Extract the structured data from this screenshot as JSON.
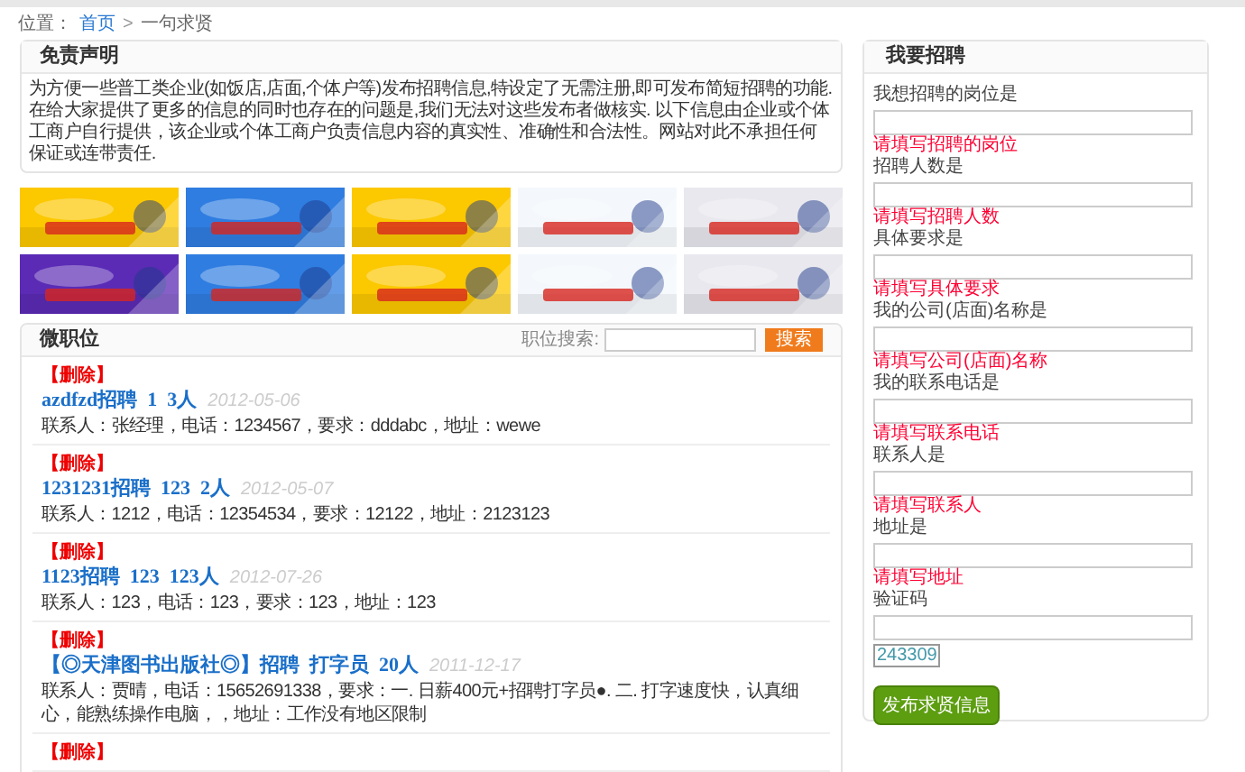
{
  "breadcrumb": {
    "label": "位置：",
    "home": "首页",
    "separator": ">",
    "current": "一句求贤"
  },
  "disclaimer": {
    "title": "免责声明",
    "text": "为方便一些普工类企业(如饭店,店面,个体户等)发布招聘信息,特设定了无需注册,即可发布简短招聘的功能.在给大家提供了更多的信息的同时也存在的问题是,我们无法对这些发布者做核实. 以下信息由企业或个体工商户自行提供，该企业或个体工商户负责信息内容的真实性、准确性和合法性。网站对此不承担任何保证或连带责任."
  },
  "jobs_panel": {
    "title": "微职位",
    "search_label": "职位搜索:",
    "search_button": "搜索",
    "jobs": [
      {
        "delete": "【删除】",
        "title": "azdfzd招聘  1  3人",
        "date": "2012-05-06",
        "details": "联系人：张经理，电话：1234567，要求：dddabc，地址：wewe"
      },
      {
        "delete": "【删除】",
        "title": "1231231招聘  123  2人",
        "date": "2012-05-07",
        "details": "联系人：1212，电话：12354534，要求：12122，地址：2123123"
      },
      {
        "delete": "【删除】",
        "title": "1123招聘  123  123人",
        "date": "2012-07-26",
        "details": "联系人：123，电话：123，要求：123，地址：123"
      },
      {
        "delete": "【删除】",
        "title": "【◎天津图书出版社◎】招聘  打字员  20人",
        "date": "2011-12-17",
        "details": "联系人：贾晴，电话：15652691338，要求：一. 日薪400元+招聘打字员●. 二. 打字速度快，认真细心，能熟练操作电脑，，地址：工作没有地区限制"
      },
      {
        "delete": "【删除】"
      }
    ]
  },
  "form": {
    "title": "我要招聘",
    "fields": [
      {
        "label": "我想招聘的岗位是",
        "error": "请填写招聘的岗位"
      },
      {
        "label": "招聘人数是",
        "error": "请填写招聘人数"
      },
      {
        "label": "具体要求是",
        "error": "请填写具体要求"
      },
      {
        "label": "我的公司(店面)名称是",
        "error": "请填写公司(店面)名称"
      },
      {
        "label": "我的联系电话是",
        "error": "请填写联系电话"
      },
      {
        "label": "联系人是",
        "error": "请填写联系人"
      },
      {
        "label": "地址是",
        "error": "请填写地址"
      },
      {
        "label": "验证码"
      }
    ],
    "captcha": "243309",
    "submit": "发布求贤信息"
  }
}
